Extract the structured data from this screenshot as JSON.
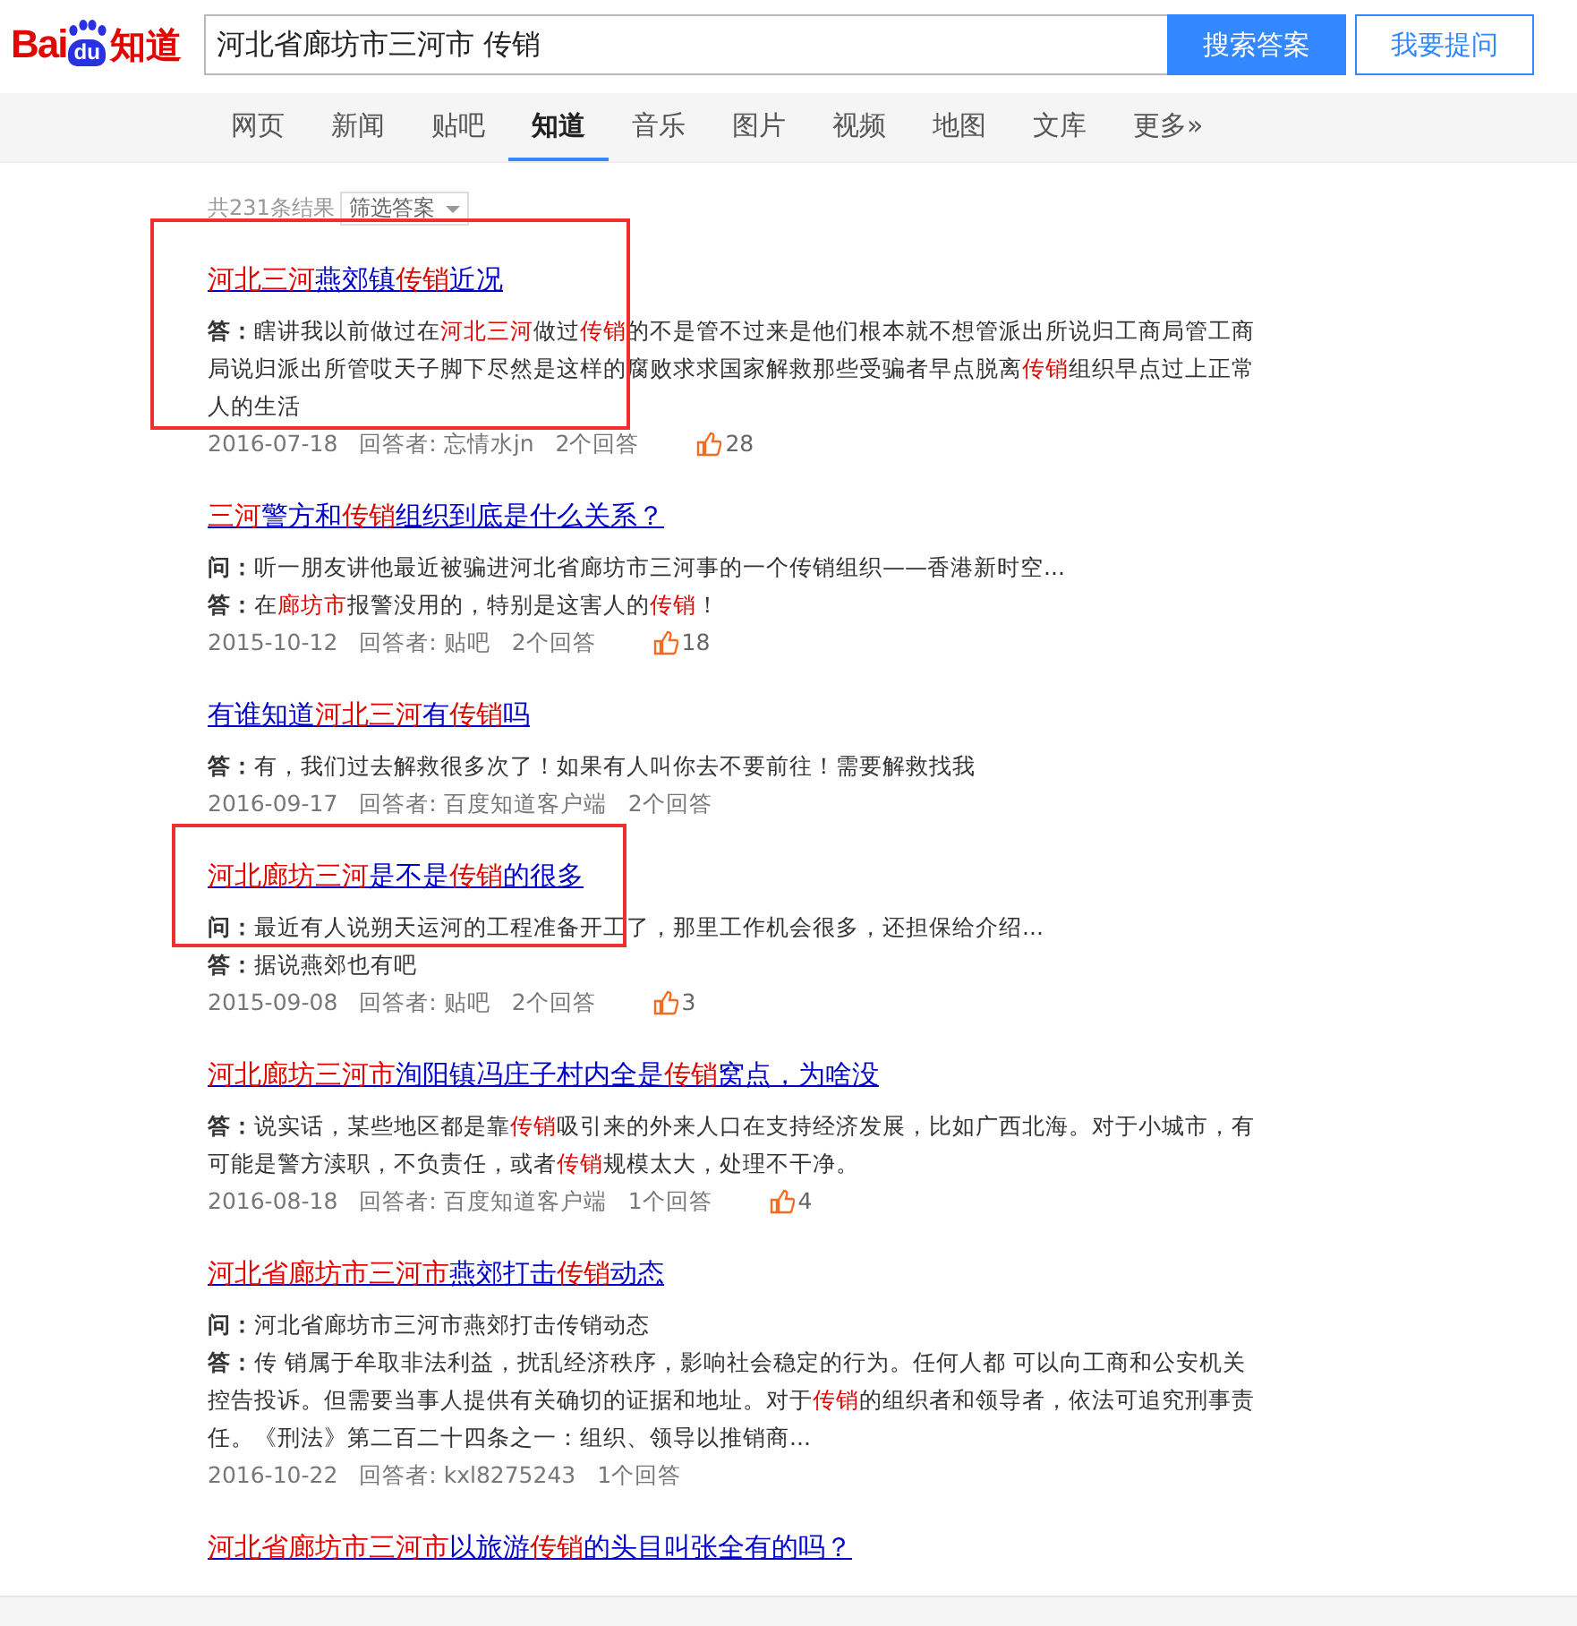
{
  "header": {
    "logo": {
      "left": "Bai",
      "mid": "du",
      "right": "知道"
    },
    "search": {
      "value": "河北省廊坊市三河市 传销"
    },
    "buttons": [
      {
        "label": "搜索答案",
        "kind": "primary"
      },
      {
        "label": "我要提问",
        "kind": "outline"
      }
    ]
  },
  "nav": [
    {
      "label": "网页",
      "selected": false
    },
    {
      "label": "新闻",
      "selected": false
    },
    {
      "label": "贴吧",
      "selected": false
    },
    {
      "label": "知道",
      "selected": true
    },
    {
      "label": "音乐",
      "selected": false
    },
    {
      "label": "图片",
      "selected": false
    },
    {
      "label": "视频",
      "selected": false
    },
    {
      "label": "地图",
      "selected": false
    },
    {
      "label": "文库",
      "selected": false
    },
    {
      "label": "更多»",
      "selected": false
    }
  ],
  "summary": {
    "count": "共231条结果",
    "filter": "筛选答案"
  },
  "results": [
    {
      "marked": true,
      "title": [
        {
          "text": "河北三河",
          "hl": true
        },
        {
          "text": "燕郊镇",
          "hl": false
        },
        {
          "text": "传销",
          "hl": true
        },
        {
          "text": "近况",
          "hl": false
        }
      ],
      "lines": [
        {
          "label": "答：",
          "parts": [
            {
              "text": "瞎讲我以前做过在",
              "hl": false
            },
            {
              "text": "河北三河",
              "hl": true
            },
            {
              "text": "做过",
              "hl": false
            },
            {
              "text": "传销",
              "hl": true
            },
            {
              "text": "的不是管不过来是他们根本就不想管派出所说归工商局管工商局说归派出所管哎天子脚下尽然是这样的腐败求求国家解救那些受骗者早点脱离",
              "hl": false
            },
            {
              "text": "传销",
              "hl": true
            },
            {
              "text": "组织早点过上正常人的生活",
              "hl": false
            }
          ]
        }
      ],
      "meta": {
        "date": "2016-07-18",
        "answerer": "回答者: 忘情水jn",
        "answers": "2个回答",
        "likes": "28"
      }
    },
    {
      "marked": false,
      "title": [
        {
          "text": "三河",
          "hl": true
        },
        {
          "text": "警方和",
          "hl": false
        },
        {
          "text": "传销",
          "hl": true
        },
        {
          "text": "组织到底是什么关系？",
          "hl": false
        }
      ],
      "lines": [
        {
          "label": "问：",
          "parts": [
            {
              "text": "听一朋友讲他最近被骗进河北省廊坊市三河事的一个传销组织——香港新时空...",
              "hl": false
            }
          ]
        },
        {
          "label": "答：",
          "parts": [
            {
              "text": "在",
              "hl": false
            },
            {
              "text": "廊坊市",
              "hl": true
            },
            {
              "text": "报警没用的，特别是这害人的",
              "hl": false
            },
            {
              "text": "传销",
              "hl": true
            },
            {
              "text": "！",
              "hl": false
            }
          ]
        }
      ],
      "meta": {
        "date": "2015-10-12",
        "answerer": "回答者: 贴吧",
        "answers": "2个回答",
        "likes": "18"
      }
    },
    {
      "marked": false,
      "title": [
        {
          "text": "有谁知道",
          "hl": false
        },
        {
          "text": "河北三河",
          "hl": true
        },
        {
          "text": "有",
          "hl": false
        },
        {
          "text": "传销",
          "hl": true
        },
        {
          "text": "吗",
          "hl": false
        }
      ],
      "lines": [
        {
          "label": "答：",
          "parts": [
            {
              "text": "有，我们过去解救很多次了！如果有人叫你去不要前往！需要解救找我",
              "hl": false
            }
          ]
        }
      ],
      "meta": {
        "date": "2016-09-17",
        "answerer": "回答者: 百度知道客户端",
        "answers": "2个回答"
      }
    },
    {
      "marked": true,
      "title": [
        {
          "text": "河北廊坊三河",
          "hl": true
        },
        {
          "text": "是不是",
          "hl": false
        },
        {
          "text": "传销",
          "hl": true
        },
        {
          "text": "的很多",
          "hl": false
        }
      ],
      "lines": [
        {
          "label": "问：",
          "parts": [
            {
              "text": "最近有人说朔天运河的工程准备开工了，那里工作机会很多，还担保给介绍...",
              "hl": false
            }
          ]
        },
        {
          "label": "答：",
          "parts": [
            {
              "text": "据说燕郊也有吧",
              "hl": false
            }
          ]
        }
      ],
      "meta": {
        "date": "2015-09-08",
        "answerer": "回答者: 贴吧",
        "answers": "2个回答",
        "likes": "3"
      }
    },
    {
      "marked": false,
      "title": [
        {
          "text": "河北廊坊三河市",
          "hl": true
        },
        {
          "text": "洵阳镇冯庄子村内全是",
          "hl": false
        },
        {
          "text": "传销",
          "hl": true
        },
        {
          "text": "窝点，为啥没",
          "hl": false
        }
      ],
      "lines": [
        {
          "label": "答：",
          "parts": [
            {
              "text": "说实话，某些地区都是靠",
              "hl": false
            },
            {
              "text": "传销",
              "hl": true
            },
            {
              "text": "吸引来的外来人口在支持经济发展，比如广西北海。对于小城市，有可能是警方渎职，不负责任，或者",
              "hl": false
            },
            {
              "text": "传销",
              "hl": true
            },
            {
              "text": "规模太大，处理不干净。",
              "hl": false
            }
          ]
        }
      ],
      "meta": {
        "date": "2016-08-18",
        "answerer": "回答者: 百度知道客户端",
        "answers": "1个回答",
        "likes": "4"
      }
    },
    {
      "marked": false,
      "title": [
        {
          "text": "河北省廊坊市三河市",
          "hl": true
        },
        {
          "text": "燕郊打击",
          "hl": false
        },
        {
          "text": "传销",
          "hl": true
        },
        {
          "text": "动态",
          "hl": false
        }
      ],
      "lines": [
        {
          "label": "问：",
          "parts": [
            {
              "text": "河北省廊坊市三河市燕郊打击传销动态",
              "hl": false
            }
          ]
        },
        {
          "label": "答：",
          "parts": [
            {
              "text": "传 销属于牟取非法利益，扰乱经济秩序，影响社会稳定的行为。任何人都 可以向工商和公安机关控告投诉。但需要当事人提供有关确切的证据和地址。对于",
              "hl": false
            },
            {
              "text": "传销",
              "hl": true
            },
            {
              "text": "的组织者和领导者，依法可追究刑事责任。《刑法》第二百二十四条之一：组织、领导以推销商...",
              "hl": false
            }
          ]
        }
      ],
      "meta": {
        "date": "2016-10-22",
        "answerer": "回答者: kxl8275243",
        "answers": "1个回答"
      }
    },
    {
      "marked": false,
      "title": [
        {
          "text": "河北省廊坊市三河市",
          "hl": true
        },
        {
          "text": "以旅游",
          "hl": false
        },
        {
          "text": "传销",
          "hl": true
        },
        {
          "text": "的头目叫张全有的吗？",
          "hl": false
        }
      ]
    }
  ]
}
